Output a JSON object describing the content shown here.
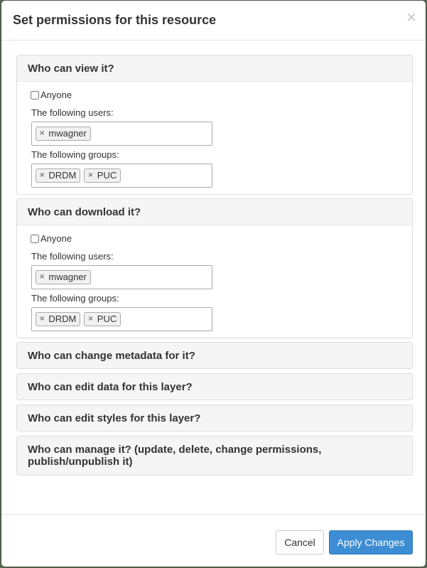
{
  "modal": {
    "title": "Set permissions for this resource",
    "close": "×"
  },
  "panels": {
    "view": {
      "title": "Who can view it?",
      "anyone_label": "Anyone",
      "users_label": "The following users:",
      "users": [
        "mwagner"
      ],
      "groups_label": "The following groups:",
      "groups": [
        "DRDM",
        "PUC"
      ]
    },
    "download": {
      "title": "Who can download it?",
      "anyone_label": "Anyone",
      "users_label": "The following users:",
      "users": [
        "mwagner"
      ],
      "groups_label": "The following groups:",
      "groups": [
        "DRDM",
        "PUC"
      ]
    },
    "metadata": {
      "title": "Who can change metadata for it?"
    },
    "edit_data": {
      "title": "Who can edit data for this layer?"
    },
    "edit_styles": {
      "title": "Who can edit styles for this layer?"
    },
    "manage": {
      "title_line1": "Who can manage it? (update, delete, change permissions,",
      "title_line2": "publish/unpublish it)"
    }
  },
  "tag_remove": "×",
  "footer": {
    "cancel_label": "Cancel",
    "apply_label": "Apply Changes"
  },
  "colors": {
    "primary": "#3c8dd3",
    "panel_heading_bg": "#f5f5f5"
  }
}
